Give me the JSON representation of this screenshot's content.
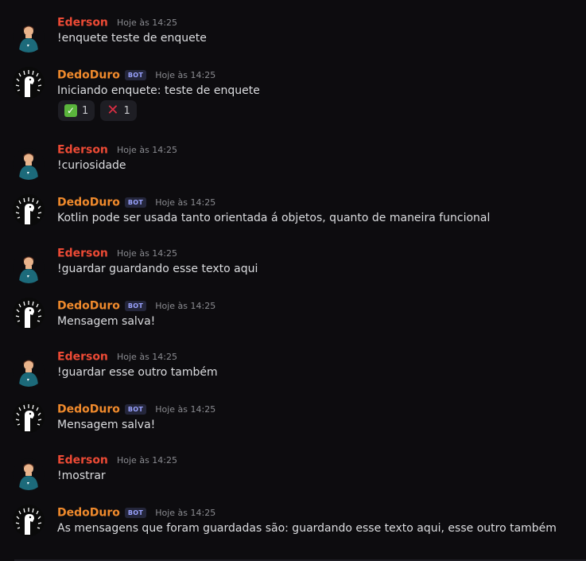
{
  "messages": [
    {
      "author": "Ederson",
      "timestamp": "Hoje às 14:25",
      "text": "!enquete teste de enquete"
    },
    {
      "author": "DedoDuro",
      "badge": "BOT",
      "timestamp": "Hoje às 14:25",
      "text": "Iniciando enquete: teste de enquete",
      "reactions": [
        {
          "emoji": "check-mark-icon",
          "count": "1"
        },
        {
          "emoji": "cross-mark-icon",
          "count": "1"
        }
      ]
    },
    {
      "author": "Ederson",
      "timestamp": "Hoje às 14:25",
      "text": "!curiosidade"
    },
    {
      "author": "DedoDuro",
      "badge": "BOT",
      "timestamp": "Hoje às 14:25",
      "text": "Kotlin pode ser usada tanto orientada á objetos, quanto de maneira funcional"
    },
    {
      "author": "Ederson",
      "timestamp": "Hoje às 14:25",
      "text": "!guardar guardando esse texto aqui"
    },
    {
      "author": "DedoDuro",
      "badge": "BOT",
      "timestamp": "Hoje às 14:25",
      "text": "Mensagem salva!"
    },
    {
      "author": "Ederson",
      "timestamp": "Hoje às 14:25",
      "text": "!guardar esse outro também"
    },
    {
      "author": "DedoDuro",
      "badge": "BOT",
      "timestamp": "Hoje às 14:25",
      "text": "Mensagem salva!"
    },
    {
      "author": "Ederson",
      "timestamp": "Hoje às 14:25",
      "text": "!mostrar"
    },
    {
      "author": "DedoDuro",
      "badge": "BOT",
      "timestamp": "Hoje às 14:25",
      "text": "As mensagens que foram guardadas são: guardando esse texto aqui, esse outro também"
    }
  ],
  "colors": {
    "background": "#0d0c0f",
    "user_name": "#ec4a35",
    "bot_name": "#f08a2c",
    "text": "#dcdde0",
    "timestamp": "#8a8b90"
  }
}
